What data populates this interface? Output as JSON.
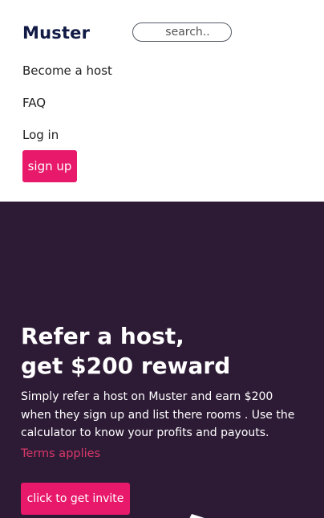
{
  "header": {
    "logo": "Muster",
    "search_placeholder": "search..",
    "nav": {
      "become_host": "Become a host",
      "faq": "FAQ",
      "login": "Log in"
    },
    "signup_label": "sign up"
  },
  "hero": {
    "title_line1": "Refer a host,",
    "title_line2": "get $200 reward",
    "body": "Simply refer a host on Muster and earn $200 when they sign up and list there rooms . Use the calculator to know your profits and payouts.",
    "terms_link": "Terms applies",
    "cta_label": "click to get invite"
  },
  "colors": {
    "brand_navy": "#111a45",
    "accent_pink": "#e8186a",
    "hero_bg": "#2d1b35",
    "terms_link": "#d9386a"
  }
}
